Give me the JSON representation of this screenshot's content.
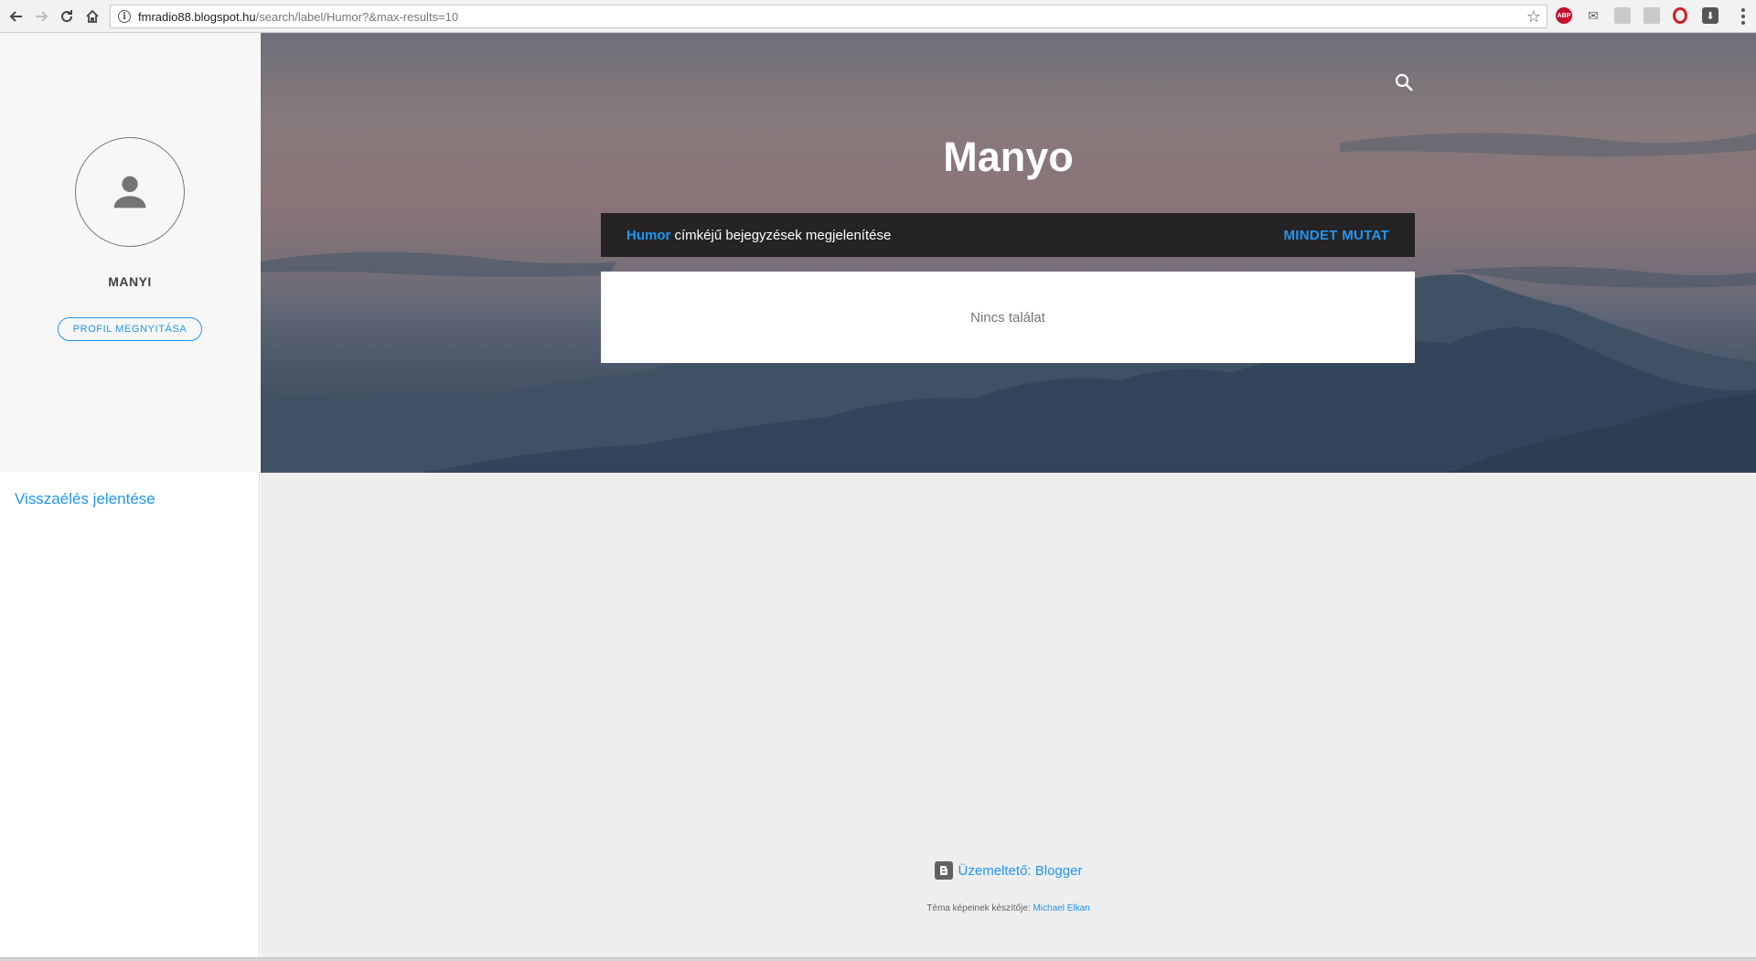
{
  "browser": {
    "url_host": "fmradio88.blogspot.hu",
    "url_path": "/search/label/Humor?&max-results=10",
    "extensions": [
      "abp-icon",
      "mail-icon",
      "extension-icon",
      "extension-icon",
      "opera-icon",
      "download-icon"
    ],
    "abp_label": "ABP"
  },
  "sidebar": {
    "profile_name": "MANYI",
    "profile_button": "PROFIL MEGNYITÁSA",
    "report_link": "Visszaélés jelentése"
  },
  "header": {
    "title": "Manyo"
  },
  "label_bar": {
    "label_name": "Humor",
    "label_suffix": " címkéjű bejegyzések megjelenítése",
    "show_all": "MINDET MUTAT"
  },
  "results": {
    "empty_text": "Nincs találat"
  },
  "footer": {
    "powered_by": "Üzemeltető: Blogger",
    "theme_credit_prefix": "Téma képeinek készítője: ",
    "theme_credit_author": "Michael Elkan"
  },
  "colors": {
    "accent": "#2196f3",
    "label_bar_bg": "#211f21",
    "page_bg": "#eeeeee"
  }
}
